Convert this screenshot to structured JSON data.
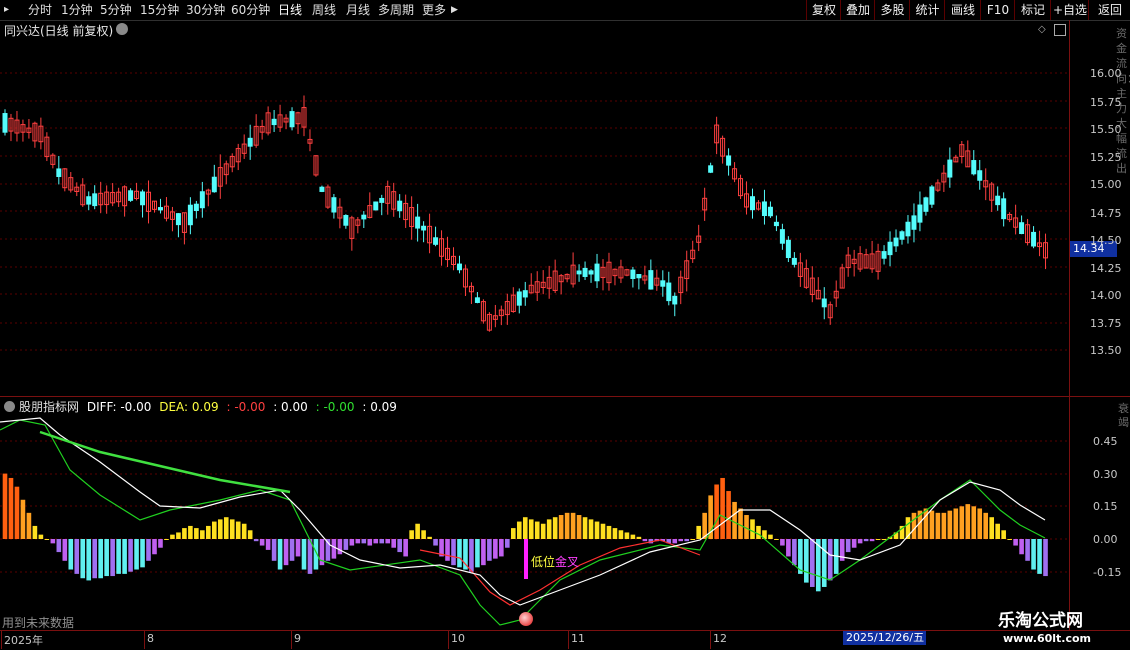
{
  "toolbar": {
    "left_items": [
      "分时",
      "1分钟",
      "5分钟",
      "15分钟",
      "30分钟",
      "60分钟",
      "日线",
      "周线",
      "月线",
      "多周期",
      "更多"
    ],
    "active": "日线",
    "right_items": [
      "复权",
      "叠加",
      "多股",
      "统计",
      "画线",
      "F10",
      "标记",
      "+自选",
      "返回"
    ]
  },
  "main": {
    "title": "同兴达(日线 前复权)",
    "current_price": "14.34",
    "y_labels": [
      "16.00",
      "15.75",
      "15.50",
      "15.25",
      "15.00",
      "14.75",
      "14.50",
      "14.25",
      "14.00",
      "13.75",
      "13.50"
    ],
    "side_text": "资金流向：主力大幅流出"
  },
  "indicator": {
    "name": "股朋指标网",
    "diff_label": "DIFF: -0.00",
    "dea_label": "DEA: 0.09",
    "v1": ": -0.00",
    "v2": ": 0.00",
    "v3": ": -0.00",
    "v4": ": 0.09",
    "y_labels": [
      "0.45",
      "0.30",
      "0.15",
      "0.00",
      "-0.15"
    ],
    "side_text": "衰竭",
    "signal_prefix": "低位",
    "signal_suffix": "金叉",
    "future_label": "用到未来数据"
  },
  "x_axis": {
    "labels": [
      "2025年",
      "8",
      "9",
      "10",
      "11",
      "12"
    ],
    "date_box": "2025/12/26/五"
  },
  "watermark": {
    "title": "乐淘公式网",
    "url": "www.60lt.com"
  },
  "colors": {
    "up": "#ff4040",
    "down": "#54fcfc",
    "grid": "#5a0000",
    "dea": "#ffffff",
    "diff_line": "#ff3030",
    "green_line": "#20d020",
    "long_line": "#40e040"
  }
}
